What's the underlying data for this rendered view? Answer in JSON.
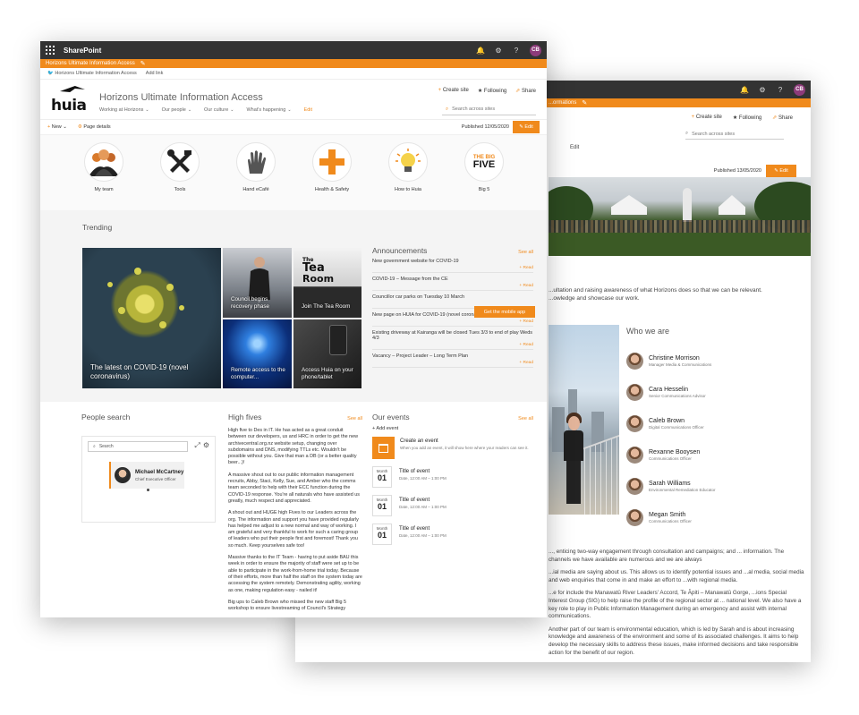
{
  "suite": {
    "brand": "SharePoint",
    "user_initials": "CB"
  },
  "front": {
    "hub": {
      "name": "Horizons Ultimate Information Access"
    },
    "subhub": {
      "link": "Horizons Ultimate Information Access",
      "add_link": "Add link"
    },
    "site": {
      "logo_text": "huia",
      "title": "Horizons Ultimate Information Access",
      "nav": [
        {
          "label": "Working at Horizons",
          "chevron": true
        },
        {
          "label": "Our people",
          "chevron": true
        },
        {
          "label": "Our culture",
          "chevron": true
        },
        {
          "label": "What's happening",
          "chevron": true
        },
        {
          "label": "Edit",
          "chevron": false
        }
      ],
      "actions": {
        "create_site": "Create site",
        "following": "Following",
        "share": "Share"
      },
      "search_placeholder": "Search across sites"
    },
    "command": {
      "new": "New",
      "page_details": "Page details",
      "published": "Published 12/05/2020",
      "edit": "Edit"
    },
    "quicklinks": [
      {
        "label": "My team",
        "icon": "team-icon"
      },
      {
        "label": "Tools",
        "icon": "tools-icon"
      },
      {
        "label": "Hand eCafé",
        "icon": "glove-icon"
      },
      {
        "label": "Health & Safety",
        "icon": "plus-cross-icon"
      },
      {
        "label": "How to Huia",
        "icon": "lightbulb-icon"
      },
      {
        "label": "Big 5",
        "icon": "big-five-icon",
        "line1": "THE BIG",
        "line2": "FIVE"
      }
    ],
    "trending": {
      "title": "Trending",
      "tiles": [
        {
          "caption": "The latest on COVID-19 (novel coronavirus)"
        },
        {
          "caption": "Council begins recovery phase"
        },
        {
          "caption": "Join The Tea Room",
          "art_line1": "The",
          "art_line2": "Tea",
          "art_line3": "Room"
        },
        {
          "caption": "Remote access to the computer..."
        },
        {
          "caption": "Access Huia on your phone/tablet"
        }
      ]
    },
    "announcements": {
      "title": "Announcements",
      "see_all": "See all",
      "read_more": "+ Read",
      "mobile_button": "Get the mobile app",
      "items": [
        {
          "text": "New government website for COVID-19"
        },
        {
          "text": "COVID-19 – Message from the CE"
        },
        {
          "text": "Councillor car parks on Tuesday 10 March"
        },
        {
          "text": "New page on HUIA for COVID-19 (novel coronavirus) information"
        },
        {
          "text": "Existing driveway at Kairanga will be closed Tues 3/3 to end of play Weds 4/3"
        },
        {
          "text": "Vacancy – Project Leader – Long Term Plan"
        }
      ]
    },
    "people_search": {
      "title": "People search",
      "placeholder": "Search",
      "person": {
        "name": "Michael McCartney",
        "role": "Chief Executive Officer"
      }
    },
    "high_fives": {
      "title": "High fives",
      "see_all": "See all",
      "paragraphs": [
        "High five to Des in IT. He has acted as a great conduit between our developers, us and HRC in order to get the new archivecentral.org.nz website setup, changing over subdomains and DNS, modifying TTLs etc. Wouldn't be possible without you. Give that man a DB (or a better quality beer...)!",
        "A massive shout out to our public information management recruits, Abby, Staci, Kelly, Sue, and Amber who the comms team seconded to help with their ECC function during the COVID-19 response. You're all naturals who have assisted us greatly, much respect and appreciated.",
        "A shout out and HUGE high Fives to our Leaders across the org. The information and support you have provided regularly has helped me adjust to a new normal and way of working. I am grateful and very thankful to work for such a caring group of leaders who put their people first and foremost! Thank you so much. Keep yourselves safe too!",
        "Massive thanks to the IT Team - having to put aside BAU this week in order to ensure the majority of staff were set up to be able to participate in the work-from-home trial today. Because of their efforts, more than half the staff on the system today are accessing the system remotely. Demonstrating agility, working as one, making regulation easy - nailed it!",
        "Big ups to Caleb Brown who missed the new staff Big 5 workshop to ensure livestreaming of Council's Strategy"
      ]
    },
    "events": {
      "title": "Our events",
      "see_all": "See all",
      "add": "+ Add event",
      "create_title": "Create an event",
      "create_desc": "When you add an event, it will show here where your readers can see it.",
      "items": [
        {
          "month": "Month",
          "day": "01",
          "title": "Title of event",
          "time": "Date, 12:00 AM – 1:00 PM"
        },
        {
          "month": "Month",
          "day": "01",
          "title": "Title of event",
          "time": "Date, 12:00 AM – 1:00 PM"
        },
        {
          "month": "Month",
          "day": "01",
          "title": "Title of event",
          "time": "Date, 12:00 AM – 1:00 PM"
        }
      ]
    }
  },
  "back": {
    "hub": {
      "name": "...ormations"
    },
    "actions": {
      "create_site": "Create site",
      "following": "Following",
      "share": "Share"
    },
    "search_placeholder": "Search across sites",
    "nav_edit": "Edit",
    "command": {
      "published": "Published 13/05/2020",
      "edit": "Edit"
    },
    "intro": "...ultation and raising awareness of what Horizons does so that we can be relevant. ...owledge and showcase our work.",
    "who_title": "Who we are",
    "people": [
      {
        "name": "Christine Morrison",
        "role": "Manager Media & Communications"
      },
      {
        "name": "Cara Hesselin",
        "role": "Senior Communications Advisor"
      },
      {
        "name": "Caleb Brown",
        "role": "Digital Communications Officer"
      },
      {
        "name": "Rexanne Booysen",
        "role": "Communications Officer"
      },
      {
        "name": "Sarah Williams",
        "role": "Environmental Remediation Educator"
      },
      {
        "name": "Megan Smith",
        "role": "Communications Officer"
      }
    ],
    "body": [
      "..., enticing two-way engagement through consultation and campaigns; and ... information. The channels we have available are numerous and we are always",
      "...ial media are saying about us. This allows us to identify potential issues and ...al media, social media and web enquiries that come in and make an effort to ...with regional media.",
      "...e for include the Manawatū River Leaders' Accord, Te Āpiti – Manawatū Gorge, ...ions Special Interest Group (SIG) to help raise the profile of the regional sector at ... national level. We also have a key role to play in Public Information Management during an emergency and assist with internal communications.",
      "Another part of our team is environmental education, which is led by Sarah and is about increasing knowledge and awareness of the environment and some of its associated challenges. It aims to help develop the necessary skills to address these issues, make informed decisions and take responsible action for the benefit of our region."
    ]
  }
}
